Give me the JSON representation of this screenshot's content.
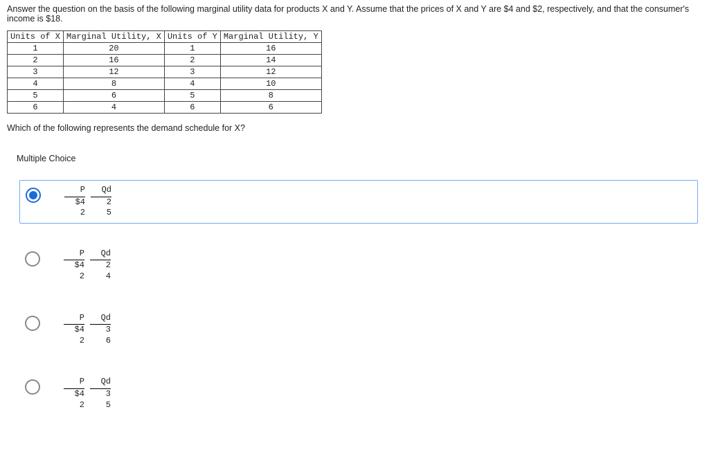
{
  "question_stem": "Answer the question on the basis of the following marginal utility data for products X and Y. Assume that the prices of X and Y are $4 and $2, respectively, and that the consumer's income is $18.",
  "table_headers": [
    "Units of X",
    "Marginal Utility, X",
    "Units of Y",
    "Marginal Utility, Y"
  ],
  "table_rows": [
    [
      "1",
      "20",
      "1",
      "16"
    ],
    [
      "2",
      "16",
      "2",
      "14"
    ],
    [
      "3",
      "12",
      "3",
      "12"
    ],
    [
      "4",
      "8",
      "4",
      "10"
    ],
    [
      "5",
      "6",
      "5",
      "8"
    ],
    [
      "6",
      "4",
      "6",
      "6"
    ]
  ],
  "sub_question": "Which of the following represents the demand schedule for X?",
  "mc_label": "Multiple Choice",
  "choices": [
    {
      "selected": true,
      "P_hdr": "P",
      "Qd_hdr": "Qd",
      "rows": [
        [
          "$4",
          "2"
        ],
        [
          "2",
          "5"
        ]
      ]
    },
    {
      "selected": false,
      "P_hdr": "P",
      "Qd_hdr": "Qd",
      "rows": [
        [
          "$4",
          "2"
        ],
        [
          "2",
          "4"
        ]
      ]
    },
    {
      "selected": false,
      "P_hdr": "P",
      "Qd_hdr": "Qd",
      "rows": [
        [
          "$4",
          "3"
        ],
        [
          "2",
          "6"
        ]
      ]
    },
    {
      "selected": false,
      "P_hdr": "P",
      "Qd_hdr": "Qd",
      "rows": [
        [
          "$4",
          "3"
        ],
        [
          "2",
          "5"
        ]
      ]
    }
  ],
  "chart_data": {
    "type": "table",
    "title": "Marginal utility data for X and Y",
    "columns": [
      "Units of X",
      "Marginal Utility X",
      "Units of Y",
      "Marginal Utility Y"
    ],
    "rows": [
      [
        1,
        20,
        1,
        16
      ],
      [
        2,
        16,
        2,
        14
      ],
      [
        3,
        12,
        3,
        12
      ],
      [
        4,
        8,
        4,
        10
      ],
      [
        5,
        6,
        5,
        8
      ],
      [
        6,
        4,
        6,
        6
      ]
    ]
  }
}
